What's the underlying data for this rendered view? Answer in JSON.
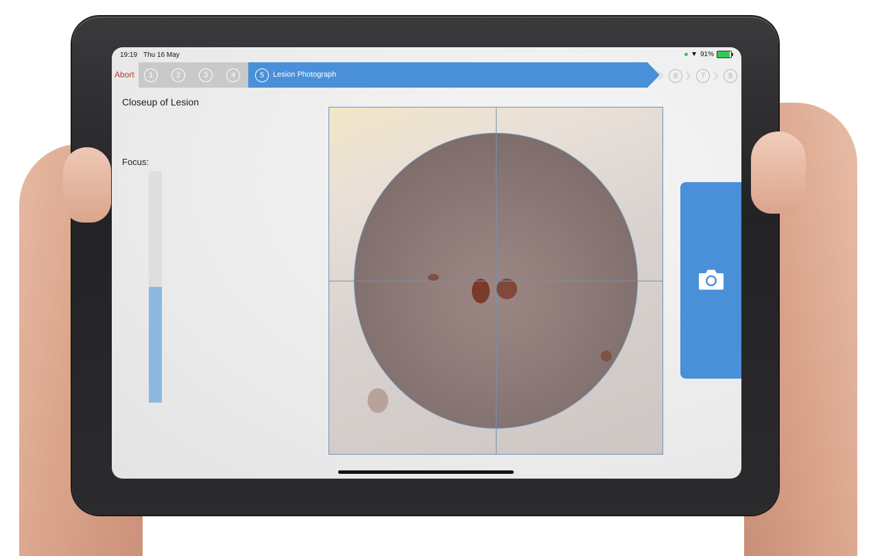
{
  "status_bar": {
    "time": "19:19",
    "date": "Thu 16 May",
    "battery": "91%"
  },
  "stepbar": {
    "abort_label": "Abort",
    "done_steps": [
      "1",
      "2",
      "3",
      "4"
    ],
    "current_step_number": "5",
    "current_step_label": "Lesion Photograph",
    "future_steps": [
      "6",
      "7",
      "8"
    ]
  },
  "main": {
    "title": "Closeup of Lesion",
    "focus_label": "Focus:",
    "focus_level": 0.5
  },
  "icons": {
    "capture": "camera-icon"
  },
  "colors": {
    "accent": "#4a90d9",
    "abort": "#c0392b",
    "focus_fill": "#8ab8e3"
  }
}
